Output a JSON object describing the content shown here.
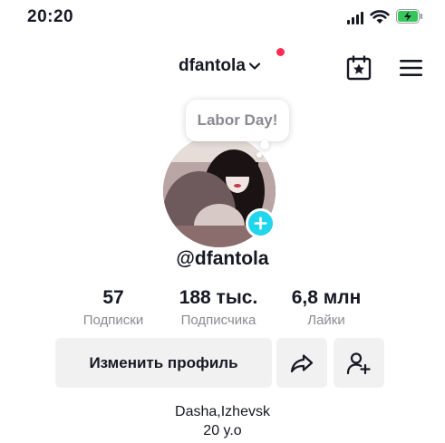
{
  "status_bar": {
    "time": "20:20"
  },
  "header": {
    "username": "dfantola"
  },
  "tooltip": {
    "text": "Labor Day!"
  },
  "profile": {
    "handle": "@dfantola"
  },
  "stats": [
    {
      "value": "57",
      "label": "Подписки"
    },
    {
      "value": "188 тыс.",
      "label": "Подписчика"
    },
    {
      "value": "6,8 млн",
      "label": "Лайки"
    }
  ],
  "actions": {
    "edit_label": "Изменить профиль"
  },
  "bio": {
    "line1": "Dasha,Izhevsk",
    "line2": "20 y.o"
  },
  "colors": {
    "accent_badge": "#20d5ec",
    "notification_dot": "#fe2c55",
    "battery_fill": "#34c759",
    "button_bg": "#f1f1f2",
    "secondary_text": "#8a8b91"
  },
  "icons": {
    "signal": "cellular-signal-icon",
    "wifi": "wifi-icon",
    "battery": "battery-charging-icon",
    "calendar": "calendar-star-icon",
    "menu": "hamburger-menu-icon",
    "share": "share-arrow-icon",
    "add_friend": "add-friend-icon",
    "add": "plus-icon",
    "dropdown": "chevron-down-icon"
  }
}
